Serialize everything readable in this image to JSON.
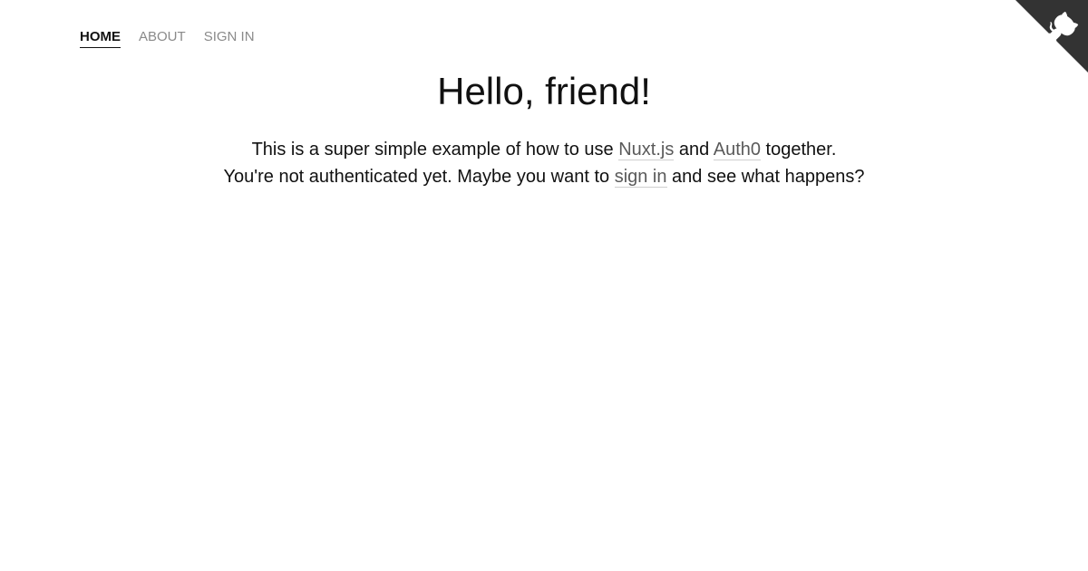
{
  "nav": {
    "items": [
      {
        "label": "HOME"
      },
      {
        "label": "ABOUT"
      },
      {
        "label": "SIGN IN"
      }
    ]
  },
  "main": {
    "title": "Hello, friend!",
    "line1": {
      "before": "This is a super simple example of how to use ",
      "link1": "Nuxt.js",
      "middle": " and ",
      "link2": "Auth0",
      "after": " together."
    },
    "line2": {
      "before": "You're not authenticated yet. Maybe you want to ",
      "link": "sign in",
      "after": " and see what happens?"
    }
  },
  "corner": {
    "icon": "github-octocat-icon",
    "background_color": "#333333",
    "icon_color": "#ffffff"
  }
}
